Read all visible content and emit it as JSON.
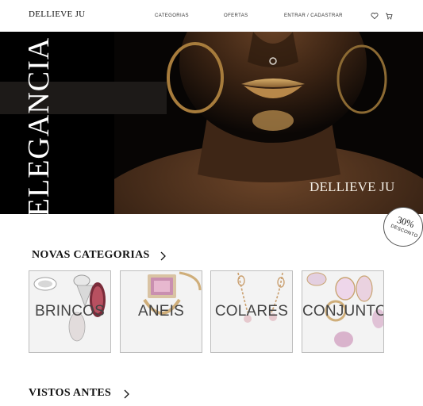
{
  "header": {
    "logo": "DELLIEVE JU",
    "nav": {
      "categories": "CATEGORIAS",
      "offers": "OFERTAS",
      "account": "ENTRAR / CADASTRAR"
    },
    "icons": [
      "heart-icon",
      "cart-icon"
    ]
  },
  "hero": {
    "vertical_text": "ELEGANCIA",
    "watermark": "DELLIEVE JU"
  },
  "badge": {
    "percent": "30%",
    "label": "DESCONTO"
  },
  "new_categories": {
    "title": "NOVAS CATEGORIAS",
    "items": [
      {
        "label": "BRINCOS"
      },
      {
        "label": "ANEIS"
      },
      {
        "label": "COLARES"
      },
      {
        "label": "CONJUNTO"
      }
    ]
  },
  "seen_before": {
    "title": "VISTOS ANTES"
  },
  "colors": {
    "background": "#ffffff",
    "hero_dark": "#000000",
    "text": "#111111",
    "card_bg": "#f3f3f3"
  }
}
